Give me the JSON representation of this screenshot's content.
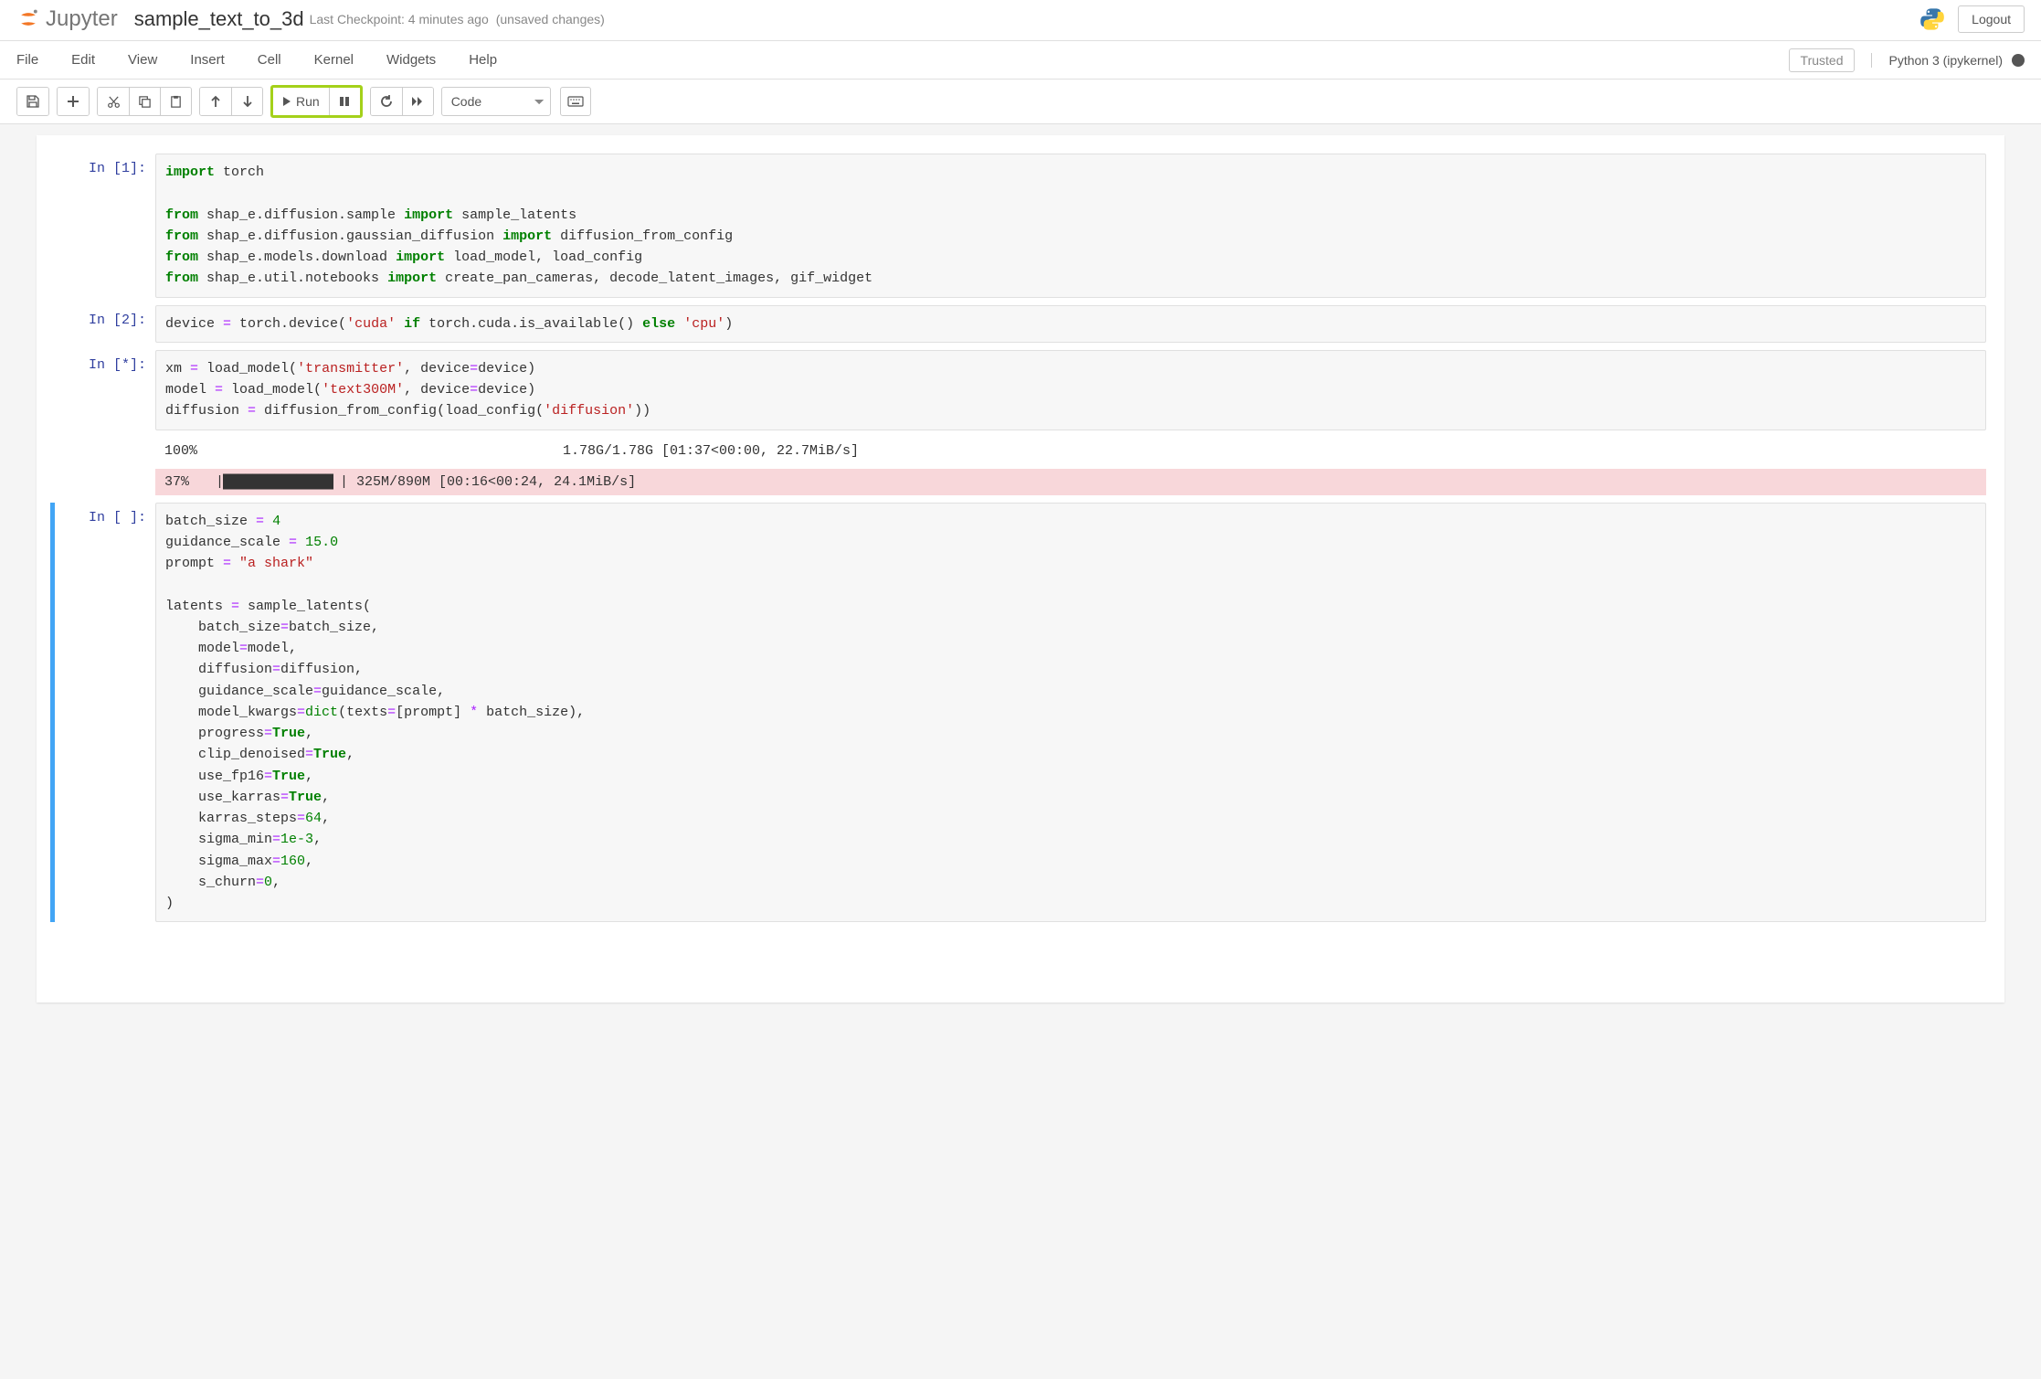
{
  "header": {
    "brand": "Jupyter",
    "title": "sample_text_to_3d",
    "checkpoint": "Last Checkpoint: 4 minutes ago",
    "unsaved": "(unsaved changes)",
    "logout": "Logout"
  },
  "menus": [
    "File",
    "Edit",
    "View",
    "Insert",
    "Cell",
    "Kernel",
    "Widgets",
    "Help"
  ],
  "menubar_trusted": "Trusted",
  "kernel_name": "Python 3 (ipykernel)",
  "toolbar": {
    "run_label": "Run",
    "cell_type_value": "Code"
  },
  "cells": [
    {
      "prompt": "In [1]:",
      "code_tokens": [
        {
          "t": "import",
          "c": "kw"
        },
        {
          "t": " torch\n\n"
        },
        {
          "t": "from",
          "c": "kw"
        },
        {
          "t": " shap_e.diffusion.sample "
        },
        {
          "t": "import",
          "c": "kw"
        },
        {
          "t": " sample_latents\n"
        },
        {
          "t": "from",
          "c": "kw"
        },
        {
          "t": " shap_e.diffusion.gaussian_diffusion "
        },
        {
          "t": "import",
          "c": "kw"
        },
        {
          "t": " diffusion_from_config\n"
        },
        {
          "t": "from",
          "c": "kw"
        },
        {
          "t": " shap_e.models.download "
        },
        {
          "t": "import",
          "c": "kw"
        },
        {
          "t": " load_model, load_config\n"
        },
        {
          "t": "from",
          "c": "kw"
        },
        {
          "t": " shap_e.util.notebooks "
        },
        {
          "t": "import",
          "c": "kw"
        },
        {
          "t": " create_pan_cameras, decode_latent_images, gif_widget"
        }
      ]
    },
    {
      "prompt": "In [2]:",
      "code_tokens": [
        {
          "t": "device "
        },
        {
          "t": "=",
          "c": "op"
        },
        {
          "t": " torch.device("
        },
        {
          "t": "'cuda'",
          "c": "str"
        },
        {
          "t": " "
        },
        {
          "t": "if",
          "c": "kw"
        },
        {
          "t": " torch.cuda.is_available() "
        },
        {
          "t": "else",
          "c": "kw"
        },
        {
          "t": " "
        },
        {
          "t": "'cpu'",
          "c": "str"
        },
        {
          "t": ")"
        }
      ]
    },
    {
      "prompt": "In [*]:",
      "code_tokens": [
        {
          "t": "xm "
        },
        {
          "t": "=",
          "c": "op"
        },
        {
          "t": " load_model("
        },
        {
          "t": "'transmitter'",
          "c": "str"
        },
        {
          "t": ", device"
        },
        {
          "t": "=",
          "c": "op"
        },
        {
          "t": "device)\n"
        },
        {
          "t": "model "
        },
        {
          "t": "=",
          "c": "op"
        },
        {
          "t": " load_model("
        },
        {
          "t": "'text300M'",
          "c": "str"
        },
        {
          "t": ", device"
        },
        {
          "t": "=",
          "c": "op"
        },
        {
          "t": "device)\n"
        },
        {
          "t": "diffusion "
        },
        {
          "t": "=",
          "c": "op"
        },
        {
          "t": " diffusion_from_config(load_config("
        },
        {
          "t": "'diffusion'",
          "c": "str"
        },
        {
          "t": "))"
        }
      ],
      "output": {
        "bar1_pct": "100%",
        "bar1_fill": 100,
        "bar1_text": "1.78G/1.78G [01:37<00:00, 22.7MiB/s]",
        "bar2_pct": "37%",
        "bar2_ascii": "|███████████████                         | ",
        "bar2_text": "325M/890M [00:16<00:24, 24.1MiB/s]"
      }
    },
    {
      "prompt": "In [ ]:",
      "selected": true,
      "code_tokens": [
        {
          "t": "batch_size "
        },
        {
          "t": "=",
          "c": "op"
        },
        {
          "t": " "
        },
        {
          "t": "4",
          "c": "num"
        },
        {
          "t": "\n"
        },
        {
          "t": "guidance_scale "
        },
        {
          "t": "=",
          "c": "op"
        },
        {
          "t": " "
        },
        {
          "t": "15.0",
          "c": "num"
        },
        {
          "t": "\n"
        },
        {
          "t": "prompt "
        },
        {
          "t": "=",
          "c": "op"
        },
        {
          "t": " "
        },
        {
          "t": "\"a shark\"",
          "c": "str"
        },
        {
          "t": "\n\n"
        },
        {
          "t": "latents "
        },
        {
          "t": "=",
          "c": "op"
        },
        {
          "t": " sample_latents(\n"
        },
        {
          "t": "    batch_size"
        },
        {
          "t": "=",
          "c": "op"
        },
        {
          "t": "batch_size,\n"
        },
        {
          "t": "    model"
        },
        {
          "t": "=",
          "c": "op"
        },
        {
          "t": "model,\n"
        },
        {
          "t": "    diffusion"
        },
        {
          "t": "=",
          "c": "op"
        },
        {
          "t": "diffusion,\n"
        },
        {
          "t": "    guidance_scale"
        },
        {
          "t": "=",
          "c": "op"
        },
        {
          "t": "guidance_scale,\n"
        },
        {
          "t": "    model_kwargs"
        },
        {
          "t": "=",
          "c": "op"
        },
        {
          "t": "dict",
          "c2": "bi"
        },
        {
          "t": "(texts"
        },
        {
          "t": "=",
          "c": "op"
        },
        {
          "t": "[prompt] "
        },
        {
          "t": "*",
          "c": "op"
        },
        {
          "t": " batch_size),\n"
        },
        {
          "t": "    progress"
        },
        {
          "t": "=",
          "c": "op"
        },
        {
          "t": "True",
          "c": "kw"
        },
        {
          "t": ",\n"
        },
        {
          "t": "    clip_denoised"
        },
        {
          "t": "=",
          "c": "op"
        },
        {
          "t": "True",
          "c": "kw"
        },
        {
          "t": ",\n"
        },
        {
          "t": "    use_fp16"
        },
        {
          "t": "=",
          "c": "op"
        },
        {
          "t": "True",
          "c": "kw"
        },
        {
          "t": ",\n"
        },
        {
          "t": "    use_karras"
        },
        {
          "t": "=",
          "c": "op"
        },
        {
          "t": "True",
          "c": "kw"
        },
        {
          "t": ",\n"
        },
        {
          "t": "    karras_steps"
        },
        {
          "t": "=",
          "c": "op"
        },
        {
          "t": "64",
          "c": "num"
        },
        {
          "t": ",\n"
        },
        {
          "t": "    sigma_min"
        },
        {
          "t": "=",
          "c": "op"
        },
        {
          "t": "1e-3",
          "c": "num"
        },
        {
          "t": ",\n"
        },
        {
          "t": "    sigma_max"
        },
        {
          "t": "=",
          "c": "op"
        },
        {
          "t": "160",
          "c": "num"
        },
        {
          "t": ",\n"
        },
        {
          "t": "    s_churn"
        },
        {
          "t": "=",
          "c": "op"
        },
        {
          "t": "0",
          "c": "num"
        },
        {
          "t": ",\n"
        },
        {
          "t": ")"
        }
      ]
    }
  ]
}
